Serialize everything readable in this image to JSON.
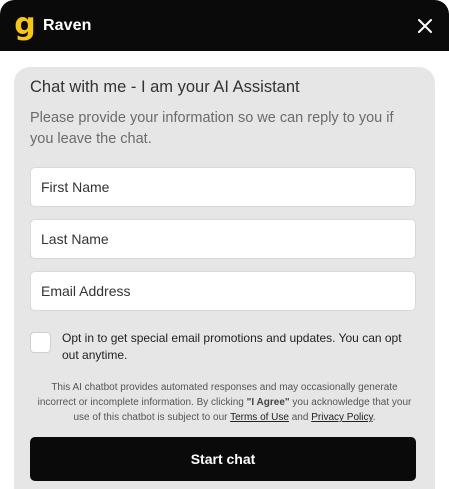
{
  "header": {
    "logo_glyph": "g",
    "brand": "Raven",
    "logo_color": "#f5c518",
    "background": "#0a0a0a",
    "close_icon": "close-icon"
  },
  "form": {
    "title": "Chat with me - I am your AI Assistant",
    "subtitle": "Please provide your information so we can reply to you if you leave the chat.",
    "fields": {
      "first_name_placeholder": "First Name",
      "last_name_placeholder": "Last Name",
      "email_placeholder": "Email Address"
    },
    "optin": {
      "checked": false,
      "label": "Opt in to get special email promotions and updates. You can opt out anytime."
    },
    "disclaimer": {
      "part1": "This AI chatbot provides automated responses and may occasionally generate incorrect or incomplete information. By clicking ",
      "agree": "\"I Agree\"",
      "part2": " you acknowledge that your use of this chatbot is subject to our ",
      "terms_link": "Terms of Use",
      "and": " and ",
      "privacy_link": "Privacy Policy",
      "end": "."
    },
    "submit_label": "Start chat"
  }
}
